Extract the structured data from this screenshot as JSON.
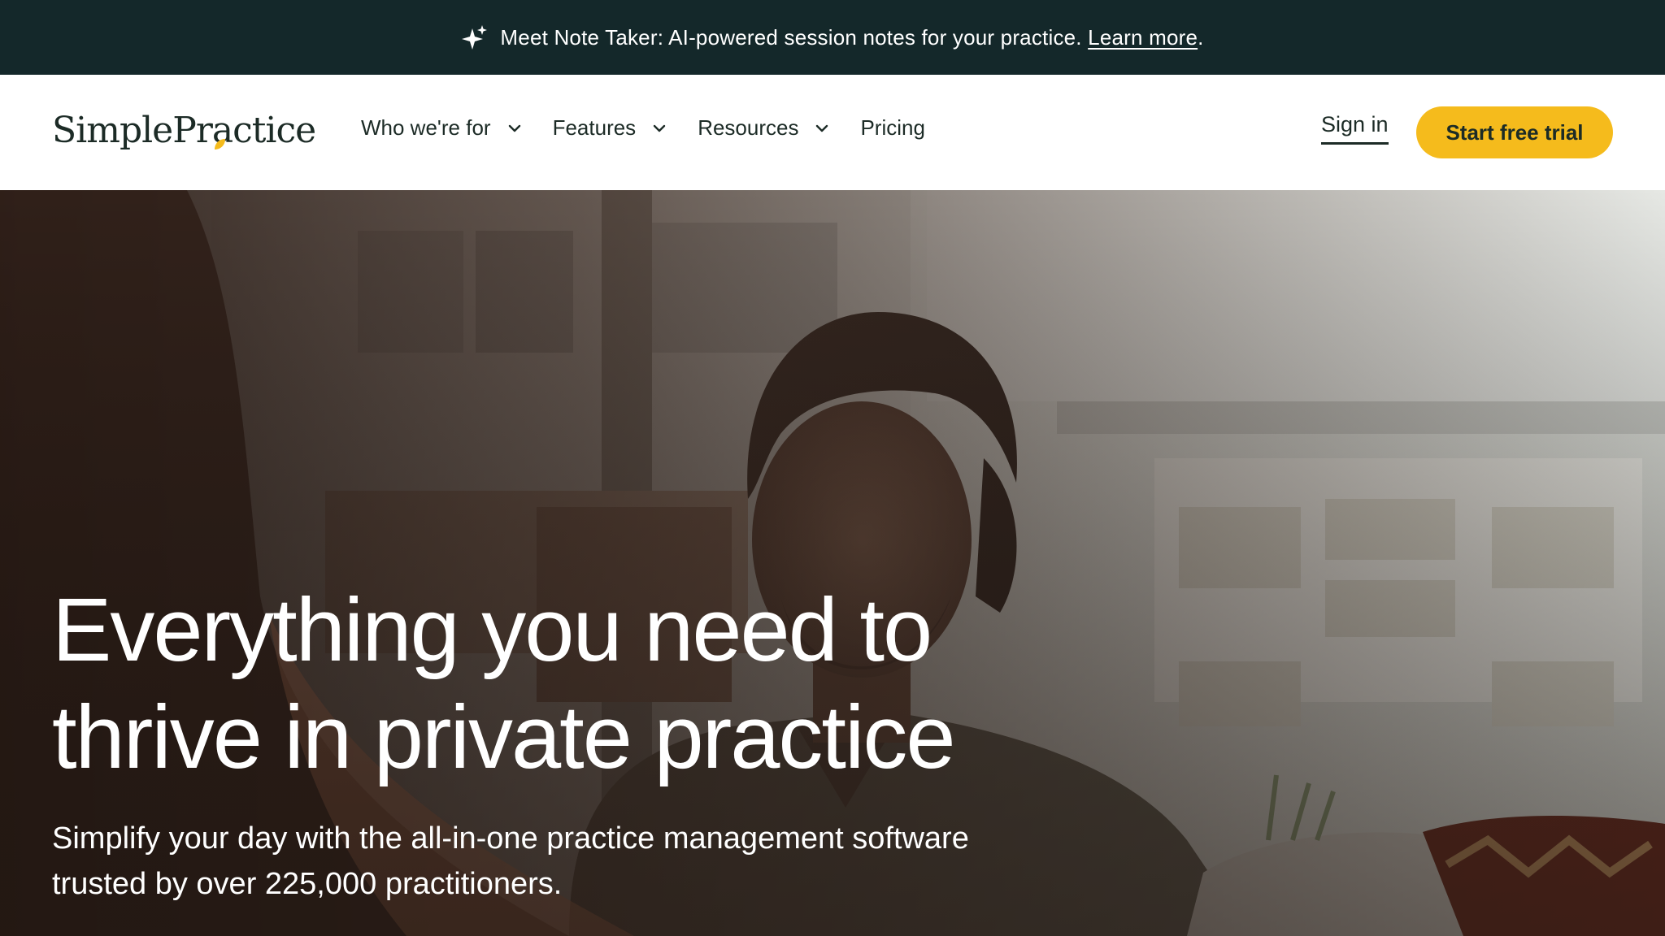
{
  "announcement": {
    "icon": "sparkle-icon",
    "text": "Meet Note Taker: AI-powered session notes for your practice.",
    "link_label": "Learn more",
    "suffix": "."
  },
  "nav": {
    "logo": "SimplePractice",
    "menu": [
      {
        "label": "Who we're for",
        "has_dropdown": true
      },
      {
        "label": "Features",
        "has_dropdown": true
      },
      {
        "label": "Resources",
        "has_dropdown": true
      },
      {
        "label": "Pricing",
        "has_dropdown": false
      }
    ],
    "sign_in": "Sign in",
    "cta": "Start free trial"
  },
  "hero": {
    "title_line1": "Everything you need to",
    "title_line2": "thrive in private practice",
    "subtitle_line1": "Simplify your day with the all-in-one practice management software",
    "subtitle_line2": "trusted by over 225,000 practitioners."
  },
  "colors": {
    "announcement_bg": "#14282a",
    "cta_bg": "#f5bb1c",
    "text_dark": "#1c2b26",
    "logo_accent": "#f5bb1c"
  }
}
